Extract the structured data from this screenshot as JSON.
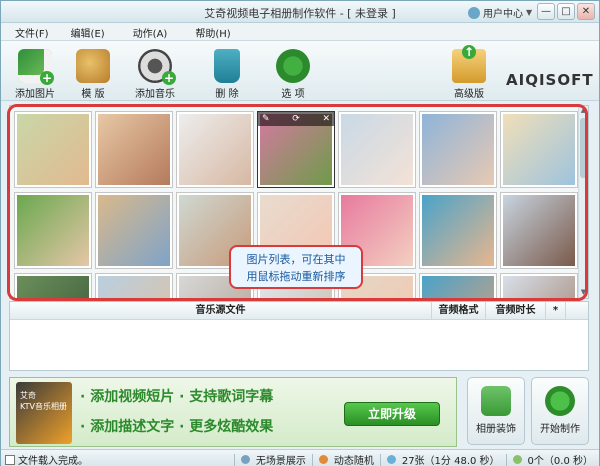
{
  "window": {
    "title": "艾奇视频电子相册制作软件 - [ 未登录 ]",
    "user_center": "用户中心",
    "btn_min": "—",
    "btn_max": "□",
    "btn_close": "✕"
  },
  "menu": [
    "文件(F)",
    "编辑(E)",
    "动作(A)",
    "帮助(H)"
  ],
  "toolbar": {
    "add_image": "添加图片",
    "template": "模 版",
    "add_music": "添加音乐",
    "delete": "删 除",
    "options": "选 项",
    "advanced": "高级版",
    "logo": "AIQISOFT"
  },
  "photos": {
    "colors": [
      [
        "#c9d7a8",
        "#e2b98f"
      ],
      [
        "#e7c8a5",
        "#b57a5d"
      ],
      [
        "#ededed",
        "#d7b8a3"
      ],
      [
        "#d47aa0",
        "#6e9b4a"
      ],
      [
        "#c9d9e6",
        "#f3e2d6"
      ],
      [
        "#8fb4d9",
        "#e7c9b3"
      ],
      [
        "#f0dfb9",
        "#9ec3dd"
      ],
      [
        "#6aa84f",
        "#e6c6a7"
      ],
      [
        "#d9b98c",
        "#7fa3c8"
      ],
      [
        "#cfd8d2",
        "#c79b7a"
      ],
      [
        "#e8dcd0",
        "#f4c6b0"
      ],
      [
        "#e87a9f",
        "#f3d0c0"
      ],
      [
        "#4aa3c9",
        "#e8b68e"
      ],
      [
        "#c8d4e0",
        "#7a5a4a"
      ],
      [
        "#6b8f5a",
        "#3a5a3a"
      ],
      [
        "#b9cfe0",
        "#e0c0a0"
      ],
      [
        "#d8d8d8",
        "#b0a090"
      ],
      [
        "#e0e8ee",
        "#c8b8a8"
      ],
      [
        "#e6d6c6",
        "#f0c8b0"
      ],
      [
        "#4aa3c9",
        "#d9a07a"
      ],
      [
        "#d8e0e8",
        "#a08070"
      ]
    ],
    "selected_index": 3,
    "sel_edit": "✎",
    "sel_rotate": "⟳",
    "sel_close": "✕"
  },
  "tooltip": {
    "line1": "图片列表，可在其中",
    "line2": "用鼠标拖动重新排序"
  },
  "music_table": {
    "col_source": "音乐源文件",
    "col_format": "音频格式",
    "col_duration": "音频时长",
    "col_star": "*"
  },
  "ad": {
    "box_line1": "艾奇",
    "box_line2": "KTV音乐相册",
    "line1": "· 添加视频短片   · 支持歌词字幕",
    "line2": "· 添加描述文字   · 更多炫酷效果",
    "upgrade": "立即升级"
  },
  "buttons": {
    "decor": "相册装饰",
    "start": "开始制作"
  },
  "status": {
    "left": "文件载入完成。",
    "nolayout": "无场景展示",
    "random": "动态随机",
    "count": "27张（1分 48.0 秒）",
    "music": "0个（0.0 秒）"
  }
}
